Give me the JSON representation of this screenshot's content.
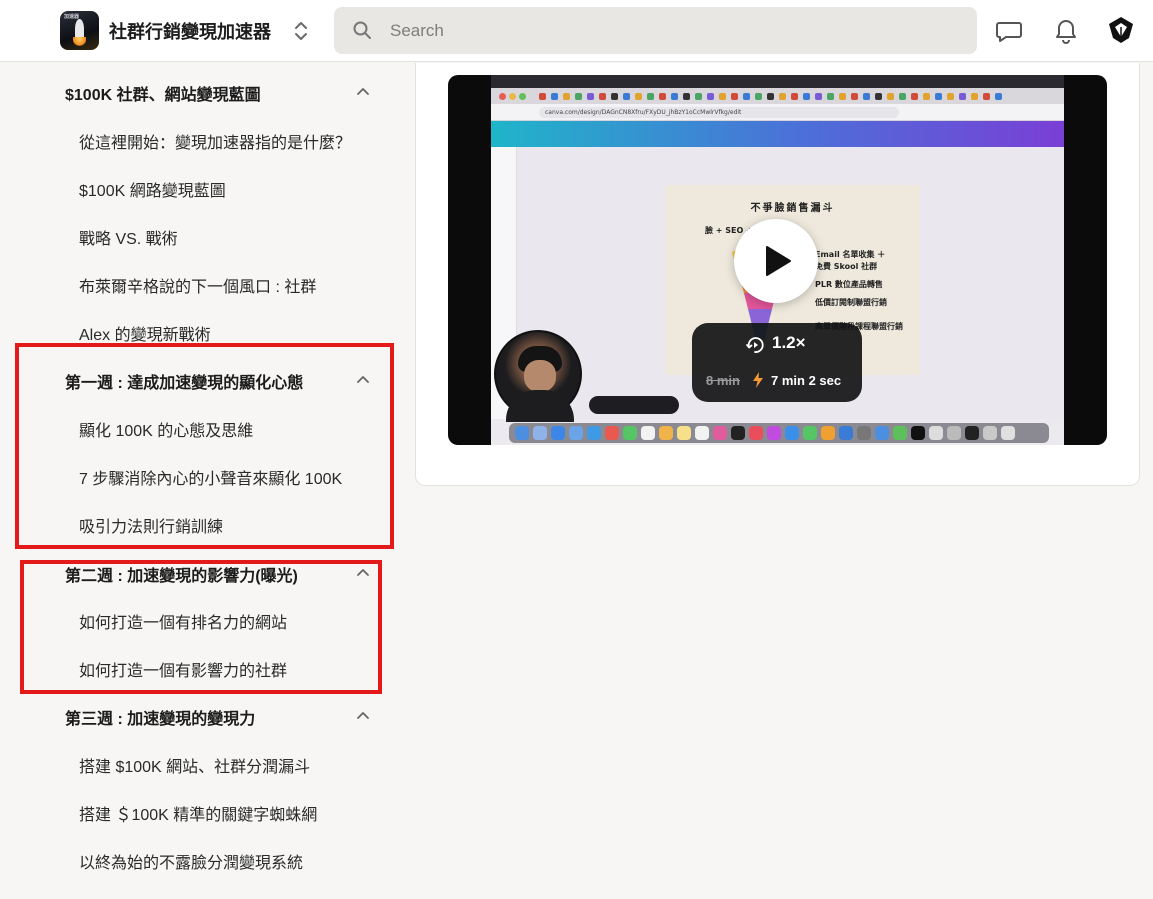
{
  "header": {
    "group_name": "社群行銷變現加速器",
    "logo_text": "加速器",
    "search": {
      "placeholder": "Search"
    },
    "icons": [
      "chat-icon",
      "bell-icon",
      "user-avatar"
    ]
  },
  "sidebar": {
    "sections": [
      {
        "title": "$100K 社群、網站變現藍圖",
        "expanded": true,
        "lessons": [
          "從這裡開始：變現加速器指的是什麼？",
          "$100K 網路變現藍圖",
          "戰略 VS. 戰術",
          "布萊爾辛格說的下一個風口 : 社群",
          "Alex 的變現新戰術"
        ]
      },
      {
        "title": "第一週 : 達成加速變現的顯化心態",
        "expanded": true,
        "lessons": [
          "顯化 100K 的心態及思維",
          "7 步驟消除內心的小聲音來顯化 100K",
          "吸引力法則行銷訓練"
        ]
      },
      {
        "title": "第二週 : 加速變現的影響力(曝光)",
        "expanded": true,
        "lessons": [
          "如何打造一個有排名力的網站",
          "如何打造一個有影響力的社群"
        ]
      },
      {
        "title": "第三週 : 加速變現的變現力",
        "expanded": true,
        "lessons": [
          "搭建 $100K 網站、社群分潤漏斗",
          "搭建 ＄100K 精準的關鍵字蜘蛛網",
          "以終為始的不露臉分潤變現系統"
        ]
      }
    ],
    "highlight_color": "#e41a1a"
  },
  "video": {
    "slide_title": "不爭臉銷售漏斗",
    "slide_lines": [
      "Email 名單收集 ＋",
      "免費 Skool 社群",
      "PLR 數位產品轉售",
      "低價訂閱制聯盟行銷",
      "高單價階段課程聯盟行銷"
    ],
    "slide_left": "臉 + SEO +",
    "speed": "1.2×",
    "original_duration": "8 min",
    "new_duration": "7 min 2 sec",
    "url": "canva.com/design/DAGnCN8Xfru/FXyDU_jhBzY1oCcMwlrVfkg/edit"
  }
}
